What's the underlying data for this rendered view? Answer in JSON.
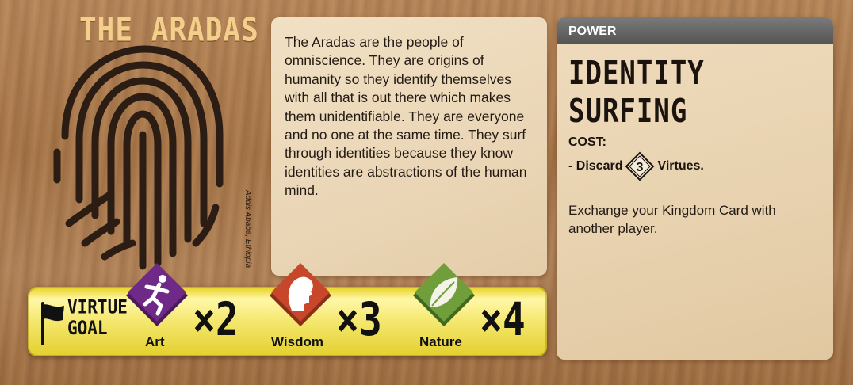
{
  "faction": {
    "name": "THE ARADAS",
    "credit": "Addis Ababa, Ethiopia",
    "lore": "The Aradas are the people of omniscience. They are origins of humanity so they identify themselves with all that is out there which makes them unidentifiable. They are everyone and no one at the same time. They surf through identities because they know identities are abstractions of the human mind."
  },
  "power": {
    "header": "POWER",
    "name": "IDENTITY SURFING",
    "cost_label": "COST:",
    "cost_prefix": "- Discard",
    "cost_amount": "3",
    "cost_suffix": "Virtues.",
    "effect": "Exchange your Kingdom Card with another player."
  },
  "virtue_goal": {
    "label_line1": "VIRTUE",
    "label_line2": "GOAL",
    "items": [
      {
        "name": "Art",
        "multiplier": "×2",
        "color": "#6e2a86",
        "icon": "dancer-icon"
      },
      {
        "name": "Wisdom",
        "multiplier": "×3",
        "color": "#c8462a",
        "icon": "head-profile-icon"
      },
      {
        "name": "Nature",
        "multiplier": "×4",
        "color": "#6f9e3a",
        "icon": "leaf-icon"
      }
    ]
  },
  "colors": {
    "title": "#f3cf8b",
    "goal_bar": "#f5e871",
    "power_header": "#666666"
  }
}
